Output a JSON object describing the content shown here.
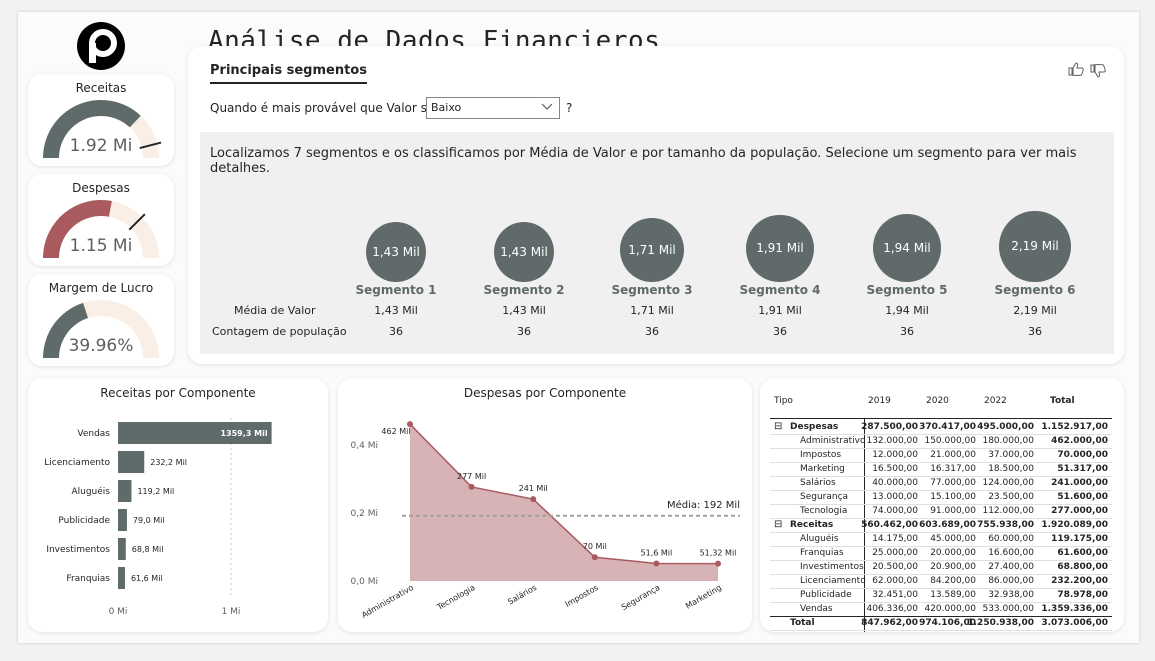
{
  "title": "Análise de Dados Financieros",
  "tab": "Principais segmentos",
  "question": {
    "label": "Quando é mais provável que Valor seja",
    "selected": "Baixo",
    "help": "?"
  },
  "kpis": [
    {
      "title": "Receitas",
      "value": "1.92 Mi",
      "fill_fraction": 0.74,
      "target_fraction": 0.92,
      "color": "#5f6a6a"
    },
    {
      "title": "Despesas",
      "value": "1.15 Mi",
      "fill_fraction": 0.56,
      "target_fraction": 0.75,
      "color": "#a95a5f"
    },
    {
      "title": "Margem de Lucro",
      "value": "39.96%",
      "fill_fraction": 0.4,
      "target_fraction": null,
      "color": "#5f6a6a"
    }
  ],
  "segments": {
    "description": "Localizamos 7 segmentos e os classificamos por Média de Valor e por tamanho da população. Selecione um segmento para ver mais detalhes.",
    "row_labels": [
      "Média de Valor",
      "Contagem de população"
    ],
    "items": [
      {
        "name": "Segmento 1",
        "bubble": "1,43 Mil",
        "media": "1,43 Mil",
        "contagem": "36"
      },
      {
        "name": "Segmento 2",
        "bubble": "1,43 Mil",
        "media": "1,43 Mil",
        "contagem": "36"
      },
      {
        "name": "Segmento 3",
        "bubble": "1,71 Mil",
        "media": "1,71 Mil",
        "contagem": "36"
      },
      {
        "name": "Segmento 4",
        "bubble": "1,91 Mil",
        "media": "1,91 Mil",
        "contagem": "36"
      },
      {
        "name": "Segmento 5",
        "bubble": "1,94 Mil",
        "media": "1,94 Mil",
        "contagem": "36"
      },
      {
        "name": "Segmento 6",
        "bubble": "2,19 Mil",
        "media": "2,19 Mil",
        "contagem": "36"
      }
    ]
  },
  "chart_data": [
    {
      "type": "bar",
      "orientation": "horizontal",
      "title": "Receitas por Componente",
      "categories": [
        "Vendas",
        "Licenciamento",
        "Aluguéis",
        "Publicidade",
        "Investimentos",
        "Franquias"
      ],
      "values": [
        1359.3,
        232.2,
        119.2,
        79.0,
        68.8,
        61.6
      ],
      "value_labels": [
        "1359,3 Mil",
        "232,2 Mil",
        "119,2 Mil",
        "79,0 Mil",
        "68,8 Mil",
        "61,6 Mil"
      ],
      "xticks": [
        "0 Mi",
        "1 Mi"
      ],
      "xlim": [
        0,
        1000
      ],
      "color": "#5f6a6a"
    },
    {
      "type": "area",
      "title": "Despesas por Componente",
      "categories": [
        "Administrativo",
        "Tecnologia",
        "Salários",
        "Impostos",
        "Segurança",
        "Marketing"
      ],
      "values": [
        462,
        277,
        241,
        70,
        51.6,
        51.32
      ],
      "value_labels": [
        "462 Mil",
        "277 Mil",
        "241 Mil",
        "70 Mil",
        "51,6 Mil",
        "51,32 Mil"
      ],
      "yticks": [
        "0,0 Mi",
        "0,2 Mi",
        "0,4 Mi"
      ],
      "ylim": [
        0,
        480
      ],
      "average": 192,
      "average_label": "Média: 192 Mil",
      "color": "#a95a5f"
    }
  ],
  "matrix": {
    "headers": [
      "Tipo",
      "2019",
      "2020",
      "2022",
      "Total"
    ],
    "groups": [
      {
        "name": "Despesas",
        "toggle": "⊟",
        "totals": [
          "287.500,00",
          "370.417,00",
          "495.000,00",
          "1.152.917,00"
        ],
        "rows": [
          {
            "name": "Administrativo",
            "values": [
              "132.000,00",
              "150.000,00",
              "180.000,00",
              "462.000,00"
            ]
          },
          {
            "name": "Impostos",
            "values": [
              "12.000,00",
              "21.000,00",
              "37.000,00",
              "70.000,00"
            ]
          },
          {
            "name": "Marketing",
            "values": [
              "16.500,00",
              "16.317,00",
              "18.500,00",
              "51.317,00"
            ]
          },
          {
            "name": "Salários",
            "values": [
              "40.000,00",
              "77.000,00",
              "124.000,00",
              "241.000,00"
            ]
          },
          {
            "name": "Segurança",
            "values": [
              "13.000,00",
              "15.100,00",
              "23.500,00",
              "51.600,00"
            ]
          },
          {
            "name": "Tecnologia",
            "values": [
              "74.000,00",
              "91.000,00",
              "112.000,00",
              "277.000,00"
            ]
          }
        ]
      },
      {
        "name": "Receitas",
        "toggle": "⊟",
        "totals": [
          "560.462,00",
          "603.689,00",
          "755.938,00",
          "1.920.089,00"
        ],
        "rows": [
          {
            "name": "Aluguéis",
            "values": [
              "14.175,00",
              "45.000,00",
              "60.000,00",
              "119.175,00"
            ]
          },
          {
            "name": "Franquias",
            "values": [
              "25.000,00",
              "20.000,00",
              "16.600,00",
              "61.600,00"
            ]
          },
          {
            "name": "Investimentos",
            "values": [
              "20.500,00",
              "20.900,00",
              "27.400,00",
              "68.800,00"
            ]
          },
          {
            "name": "Licenciamento",
            "values": [
              "62.000,00",
              "84.200,00",
              "86.000,00",
              "232.200,00"
            ]
          },
          {
            "name": "Publicidade",
            "values": [
              "32.451,00",
              "13.589,00",
              "32.938,00",
              "78.978,00"
            ]
          },
          {
            "name": "Vendas",
            "values": [
              "406.336,00",
              "420.000,00",
              "533.000,00",
              "1.359.336,00"
            ]
          }
        ]
      }
    ],
    "total": {
      "name": "Total",
      "values": [
        "847.962,00",
        "974.106,00",
        "1.250.938,00",
        "3.073.006,00"
      ]
    }
  },
  "icons": {
    "logo": "p-logo",
    "like": "thumbs-up-icon",
    "dislike": "thumbs-down-icon",
    "dropdown": "chevron-down-icon"
  }
}
